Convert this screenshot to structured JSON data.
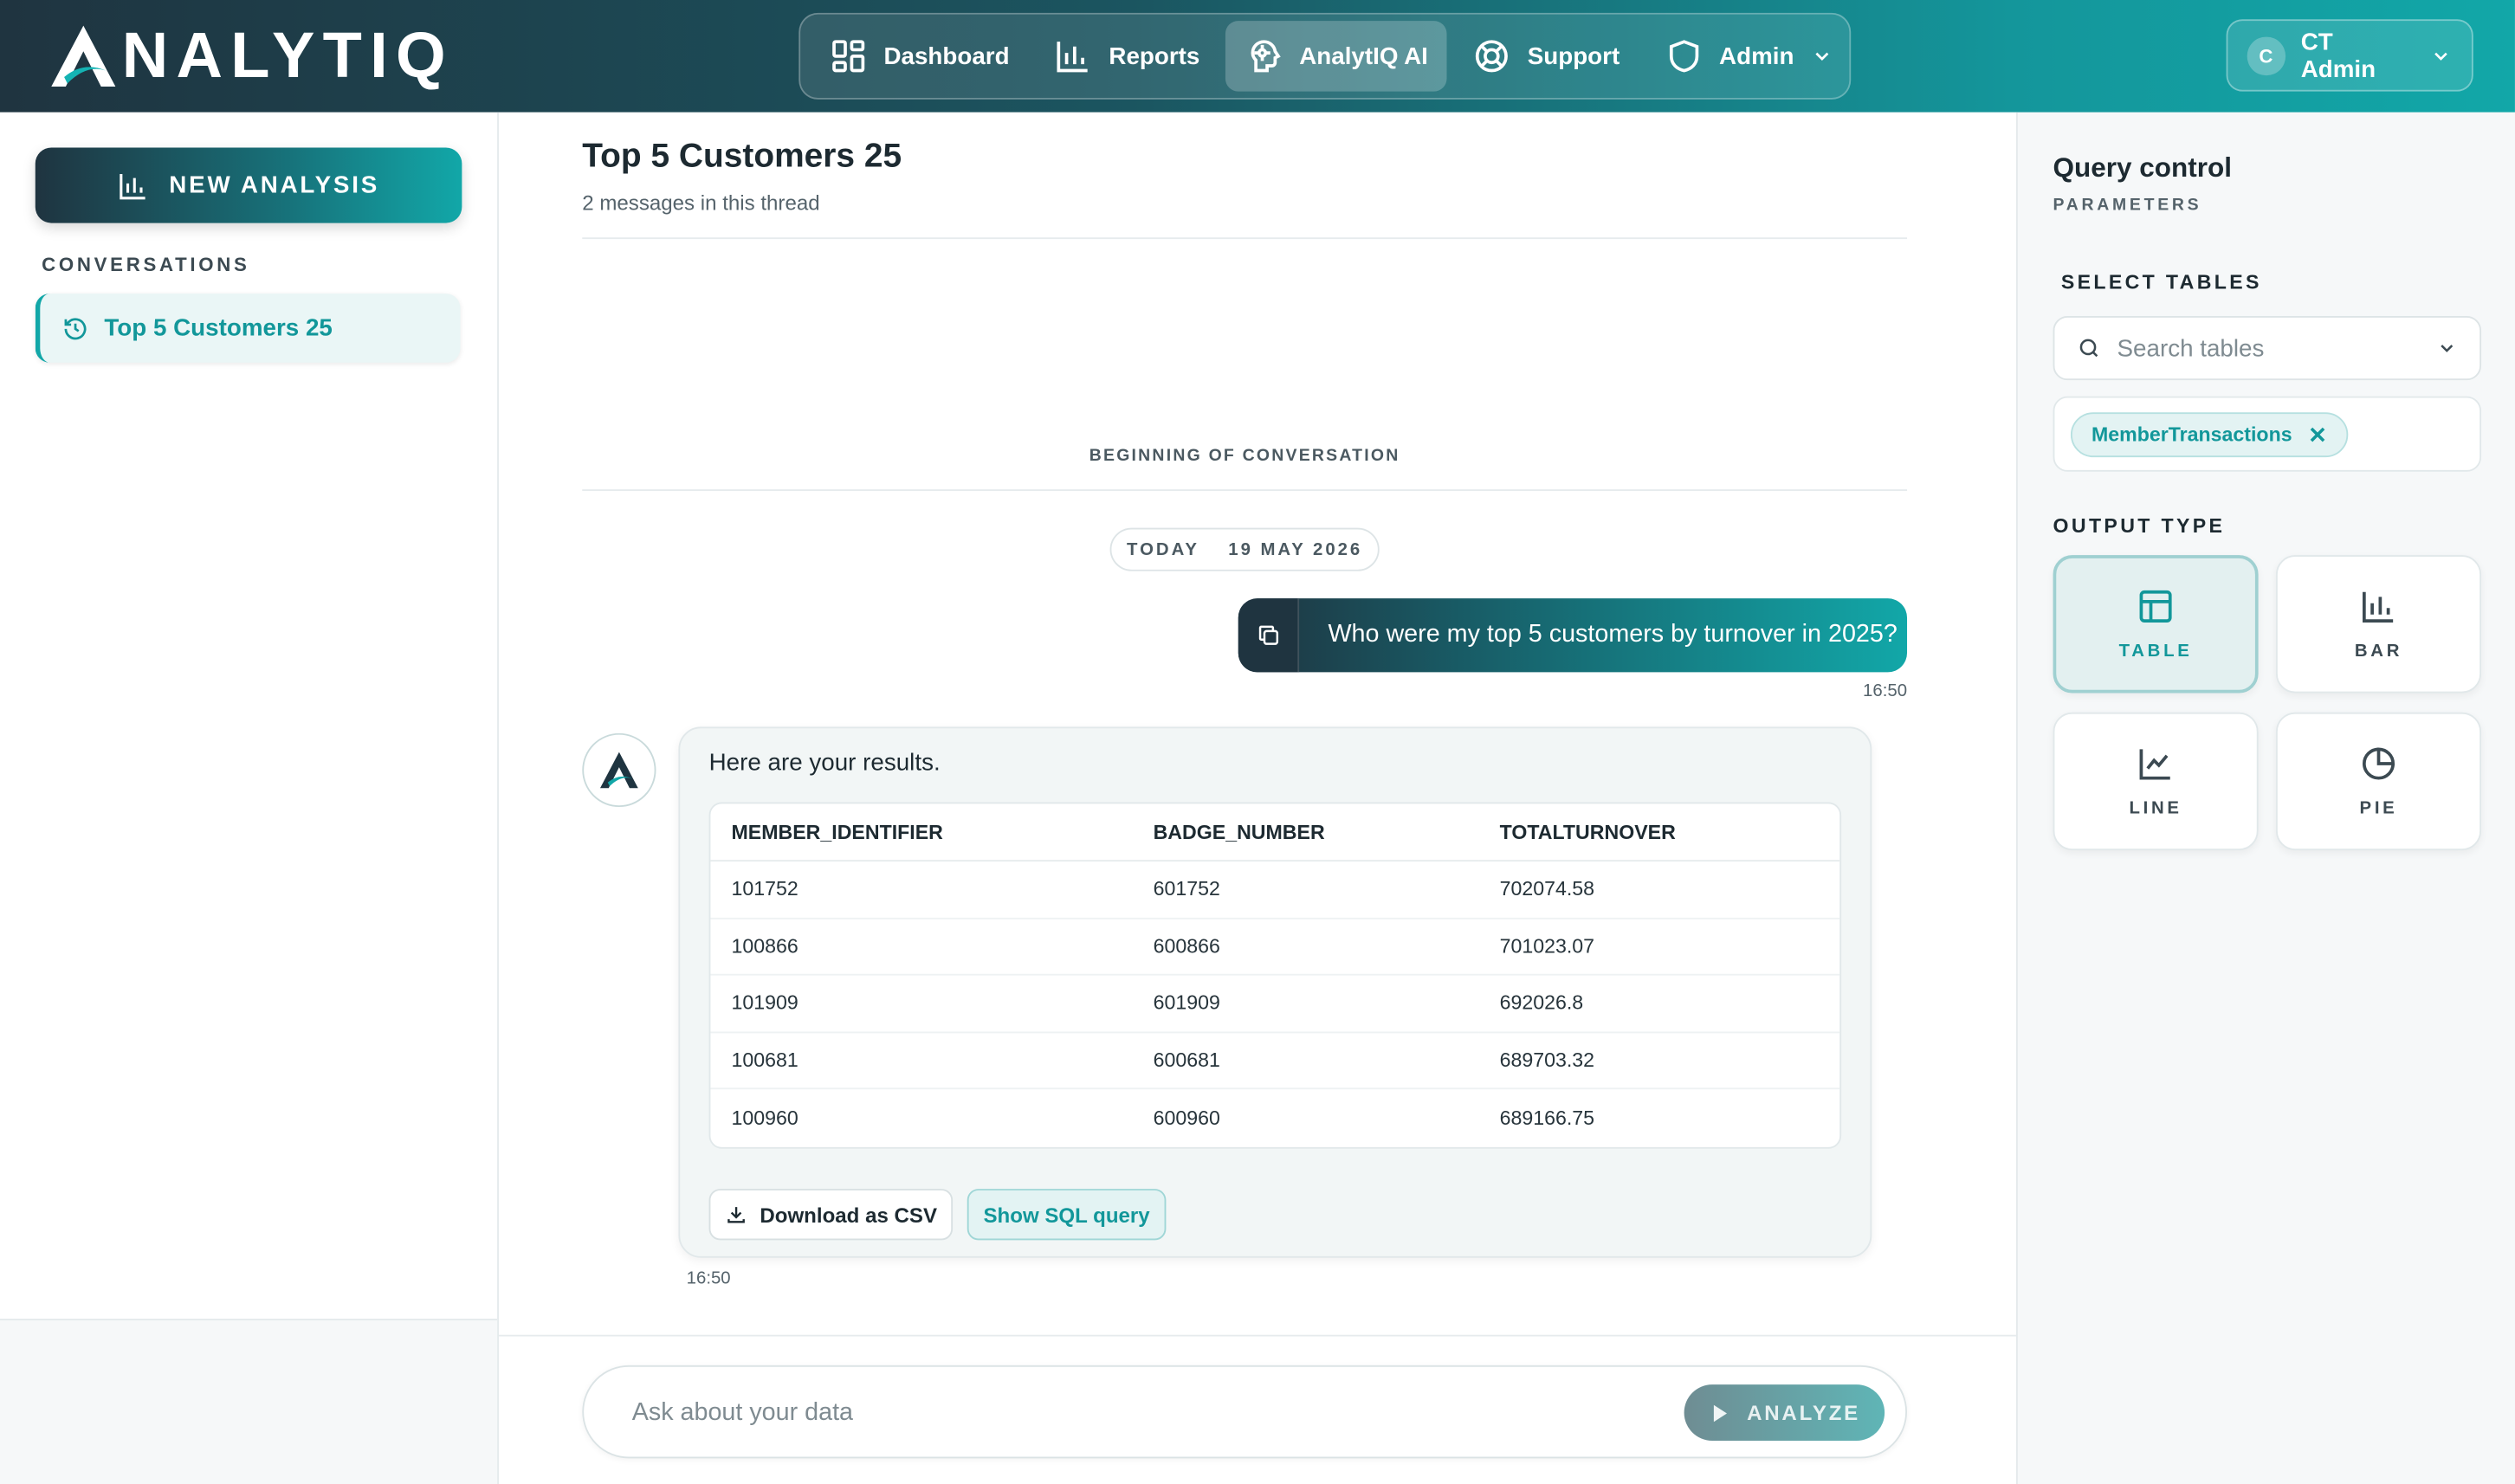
{
  "brand": {
    "name": "NALYTIQ",
    "accent": "#12a7a8",
    "dark": "#1f3440"
  },
  "nav": {
    "items": [
      {
        "label": "Dashboard",
        "icon": "dashboard-icon"
      },
      {
        "label": "Reports",
        "icon": "bar-chart-icon"
      },
      {
        "label": "AnalytIQ AI",
        "icon": "ai-head-icon",
        "active": true
      },
      {
        "label": "Support",
        "icon": "lifebuoy-icon"
      },
      {
        "label": "Admin",
        "icon": "shield-icon"
      }
    ]
  },
  "user": {
    "initial": "C",
    "name": "CT Admin"
  },
  "sidebar": {
    "new_button": "NEW ANALYSIS",
    "section_label": "CONVERSATIONS",
    "conversations": [
      {
        "label": "Top 5 Customers 25"
      }
    ]
  },
  "thread": {
    "title": "Top 5 Customers 25",
    "subtitle": "2 messages in this thread",
    "beginning": "BEGINNING OF CONVERSATION",
    "date_today": "TODAY",
    "date_value": "19 MAY 2026",
    "user_message": "Who were my top 5 customers by turnover in 2025?",
    "user_time": "16:50",
    "bot_intro": "Here are your results.",
    "bot_time": "16:50",
    "table": {
      "columns": [
        "MEMBER_IDENTIFIER",
        "BADGE_NUMBER",
        "TOTALTURNOVER"
      ],
      "rows": [
        [
          "101752",
          "601752",
          "702074.58"
        ],
        [
          "100866",
          "600866",
          "701023.07"
        ],
        [
          "101909",
          "601909",
          "692026.8"
        ],
        [
          "100681",
          "600681",
          "689703.32"
        ],
        [
          "100960",
          "600960",
          "689166.75"
        ]
      ]
    },
    "download_label": "Download as CSV",
    "sql_label": "Show SQL query"
  },
  "composer": {
    "placeholder": "Ask about your data",
    "value": "",
    "button": "ANALYZE"
  },
  "query_control": {
    "title": "Query control",
    "subtitle": "PARAMETERS",
    "select_tables_label": "SELECT TABLES",
    "search_placeholder": "Search tables",
    "selected_tables": [
      "MemberTransactions"
    ],
    "output_type_label": "OUTPUT TYPE",
    "output_types": [
      {
        "label": "TABLE",
        "icon": "table-icon",
        "selected": true
      },
      {
        "label": "BAR",
        "icon": "bar-chart-icon",
        "selected": false
      },
      {
        "label": "LINE",
        "icon": "line-chart-icon",
        "selected": false
      },
      {
        "label": "PIE",
        "icon": "pie-chart-icon",
        "selected": false
      }
    ]
  }
}
